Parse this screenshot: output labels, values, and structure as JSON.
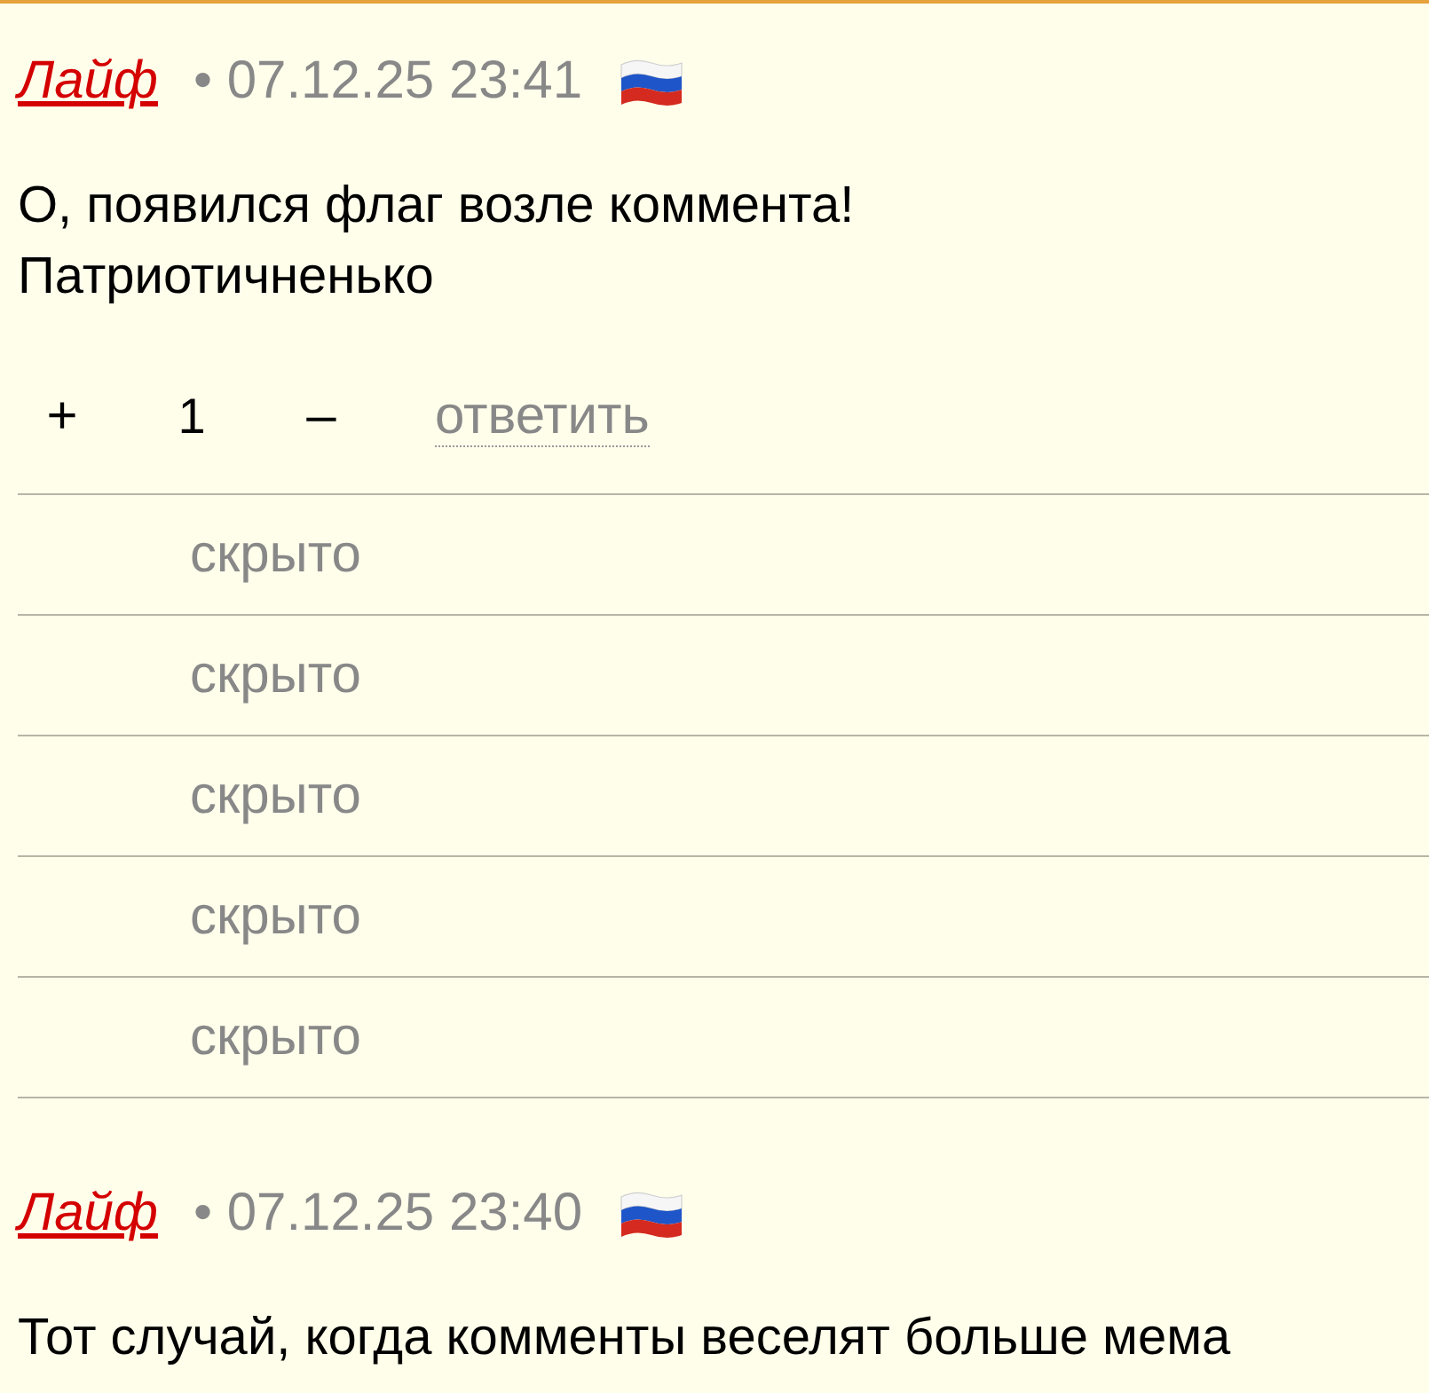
{
  "comments": [
    {
      "author": "Лайф",
      "meta": "• 07.12.25 23:41",
      "text": "О, появился флаг возле коммента!\nПатриотичненько",
      "votes": {
        "plus": "+",
        "score": "1",
        "minus": "–"
      },
      "reply": "ответить",
      "replies": [
        {
          "label": "скрыто"
        },
        {
          "label": "скрыто"
        },
        {
          "label": "скрыто"
        },
        {
          "label": "скрыто"
        },
        {
          "label": "скрыто"
        }
      ]
    },
    {
      "author": "Лайф",
      "meta": "• 07.12.25 23:40",
      "text": "Тот случай, когда комменты веселят больше мема"
    }
  ]
}
